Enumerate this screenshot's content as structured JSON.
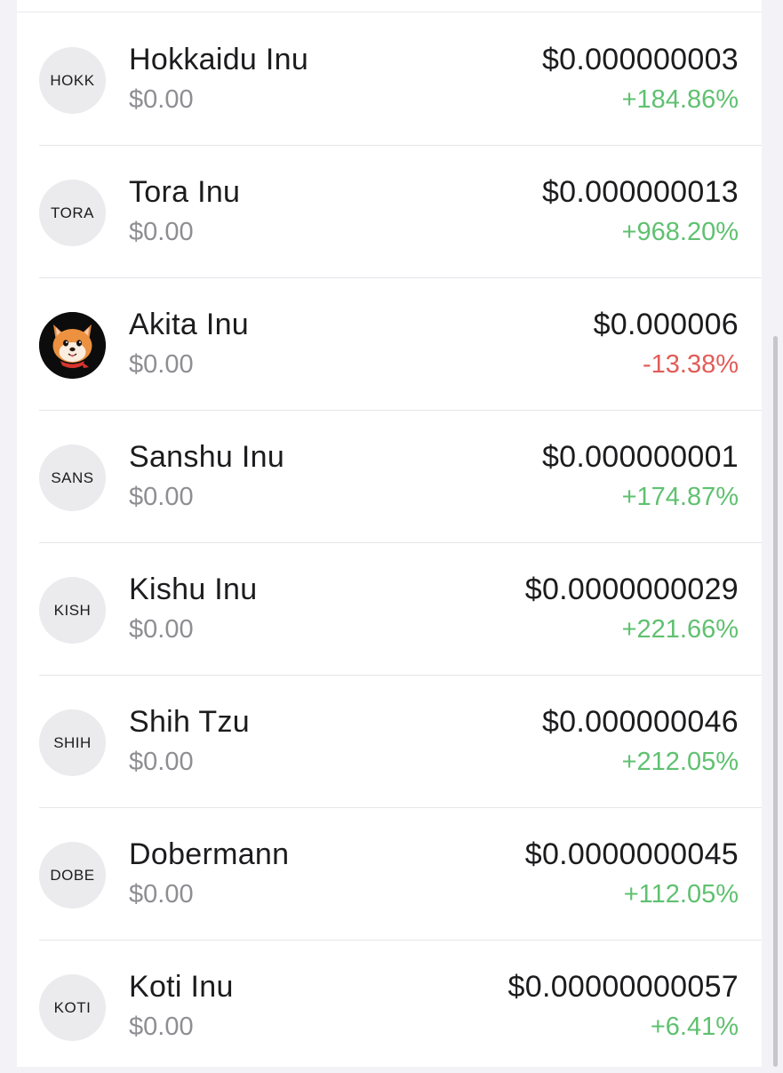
{
  "colors": {
    "positive": "#5fc170",
    "negative": "#e25c58"
  },
  "assets": [
    {
      "avatar": "HOKK",
      "name": "Hokkaidu Inu",
      "balance": "$0.00",
      "price": "$0.000000003",
      "change": "+184.86%",
      "trend": "positive"
    },
    {
      "avatar": "TORA",
      "name": "Tora Inu",
      "balance": "$0.00",
      "price": "$0.000000013",
      "change": "+968.20%",
      "trend": "positive"
    },
    {
      "avatar": "",
      "avatar_icon": "shiba-dog-face-icon",
      "name": "Akita Inu",
      "balance": "$0.00",
      "price": "$0.000006",
      "change": "-13.38%",
      "trend": "negative"
    },
    {
      "avatar": "SANS",
      "name": "Sanshu Inu",
      "balance": "$0.00",
      "price": "$0.000000001",
      "change": "+174.87%",
      "trend": "positive"
    },
    {
      "avatar": "KISH",
      "name": "Kishu Inu",
      "balance": "$0.00",
      "price": "$0.0000000029",
      "change": "+221.66%",
      "trend": "positive"
    },
    {
      "avatar": "SHIH",
      "name": "Shih Tzu",
      "balance": "$0.00",
      "price": "$0.000000046",
      "change": "+212.05%",
      "trend": "positive"
    },
    {
      "avatar": "DOBE",
      "name": "Dobermann",
      "balance": "$0.00",
      "price": "$0.0000000045",
      "change": "+112.05%",
      "trend": "positive"
    },
    {
      "avatar": "KOTI",
      "name": "Koti Inu",
      "balance": "$0.00",
      "price": "$0.00000000057",
      "change": "+6.41%",
      "trend": "positive"
    }
  ]
}
